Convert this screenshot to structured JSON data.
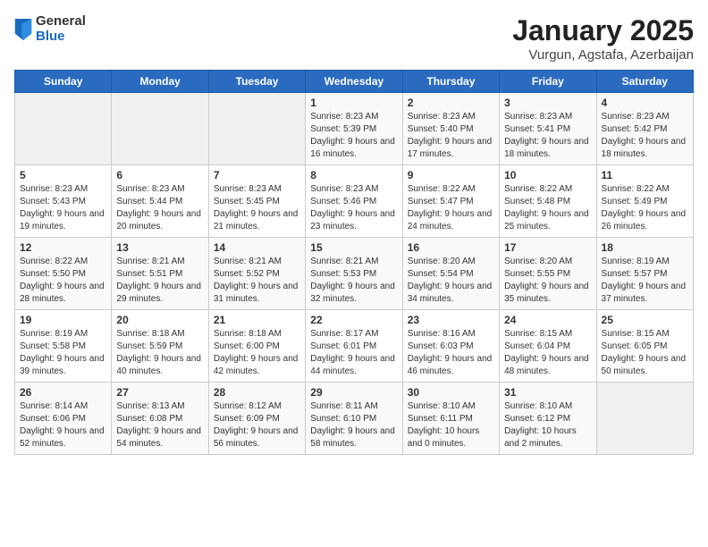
{
  "header": {
    "logo_general": "General",
    "logo_blue": "Blue",
    "title": "January 2025",
    "subtitle": "Vurgun, Agstafa, Azerbaijan"
  },
  "days_of_week": [
    "Sunday",
    "Monday",
    "Tuesday",
    "Wednesday",
    "Thursday",
    "Friday",
    "Saturday"
  ],
  "weeks": [
    [
      {
        "day": "",
        "info": ""
      },
      {
        "day": "",
        "info": ""
      },
      {
        "day": "",
        "info": ""
      },
      {
        "day": "1",
        "info": "Sunrise: 8:23 AM\nSunset: 5:39 PM\nDaylight: 9 hours and 16 minutes."
      },
      {
        "day": "2",
        "info": "Sunrise: 8:23 AM\nSunset: 5:40 PM\nDaylight: 9 hours and 17 minutes."
      },
      {
        "day": "3",
        "info": "Sunrise: 8:23 AM\nSunset: 5:41 PM\nDaylight: 9 hours and 18 minutes."
      },
      {
        "day": "4",
        "info": "Sunrise: 8:23 AM\nSunset: 5:42 PM\nDaylight: 9 hours and 18 minutes."
      }
    ],
    [
      {
        "day": "5",
        "info": "Sunrise: 8:23 AM\nSunset: 5:43 PM\nDaylight: 9 hours and 19 minutes."
      },
      {
        "day": "6",
        "info": "Sunrise: 8:23 AM\nSunset: 5:44 PM\nDaylight: 9 hours and 20 minutes."
      },
      {
        "day": "7",
        "info": "Sunrise: 8:23 AM\nSunset: 5:45 PM\nDaylight: 9 hours and 21 minutes."
      },
      {
        "day": "8",
        "info": "Sunrise: 8:23 AM\nSunset: 5:46 PM\nDaylight: 9 hours and 23 minutes."
      },
      {
        "day": "9",
        "info": "Sunrise: 8:22 AM\nSunset: 5:47 PM\nDaylight: 9 hours and 24 minutes."
      },
      {
        "day": "10",
        "info": "Sunrise: 8:22 AM\nSunset: 5:48 PM\nDaylight: 9 hours and 25 minutes."
      },
      {
        "day": "11",
        "info": "Sunrise: 8:22 AM\nSunset: 5:49 PM\nDaylight: 9 hours and 26 minutes."
      }
    ],
    [
      {
        "day": "12",
        "info": "Sunrise: 8:22 AM\nSunset: 5:50 PM\nDaylight: 9 hours and 28 minutes."
      },
      {
        "day": "13",
        "info": "Sunrise: 8:21 AM\nSunset: 5:51 PM\nDaylight: 9 hours and 29 minutes."
      },
      {
        "day": "14",
        "info": "Sunrise: 8:21 AM\nSunset: 5:52 PM\nDaylight: 9 hours and 31 minutes."
      },
      {
        "day": "15",
        "info": "Sunrise: 8:21 AM\nSunset: 5:53 PM\nDaylight: 9 hours and 32 minutes."
      },
      {
        "day": "16",
        "info": "Sunrise: 8:20 AM\nSunset: 5:54 PM\nDaylight: 9 hours and 34 minutes."
      },
      {
        "day": "17",
        "info": "Sunrise: 8:20 AM\nSunset: 5:55 PM\nDaylight: 9 hours and 35 minutes."
      },
      {
        "day": "18",
        "info": "Sunrise: 8:19 AM\nSunset: 5:57 PM\nDaylight: 9 hours and 37 minutes."
      }
    ],
    [
      {
        "day": "19",
        "info": "Sunrise: 8:19 AM\nSunset: 5:58 PM\nDaylight: 9 hours and 39 minutes."
      },
      {
        "day": "20",
        "info": "Sunrise: 8:18 AM\nSunset: 5:59 PM\nDaylight: 9 hours and 40 minutes."
      },
      {
        "day": "21",
        "info": "Sunrise: 8:18 AM\nSunset: 6:00 PM\nDaylight: 9 hours and 42 minutes."
      },
      {
        "day": "22",
        "info": "Sunrise: 8:17 AM\nSunset: 6:01 PM\nDaylight: 9 hours and 44 minutes."
      },
      {
        "day": "23",
        "info": "Sunrise: 8:16 AM\nSunset: 6:03 PM\nDaylight: 9 hours and 46 minutes."
      },
      {
        "day": "24",
        "info": "Sunrise: 8:15 AM\nSunset: 6:04 PM\nDaylight: 9 hours and 48 minutes."
      },
      {
        "day": "25",
        "info": "Sunrise: 8:15 AM\nSunset: 6:05 PM\nDaylight: 9 hours and 50 minutes."
      }
    ],
    [
      {
        "day": "26",
        "info": "Sunrise: 8:14 AM\nSunset: 6:06 PM\nDaylight: 9 hours and 52 minutes."
      },
      {
        "day": "27",
        "info": "Sunrise: 8:13 AM\nSunset: 6:08 PM\nDaylight: 9 hours and 54 minutes."
      },
      {
        "day": "28",
        "info": "Sunrise: 8:12 AM\nSunset: 6:09 PM\nDaylight: 9 hours and 56 minutes."
      },
      {
        "day": "29",
        "info": "Sunrise: 8:11 AM\nSunset: 6:10 PM\nDaylight: 9 hours and 58 minutes."
      },
      {
        "day": "30",
        "info": "Sunrise: 8:10 AM\nSunset: 6:11 PM\nDaylight: 10 hours and 0 minutes."
      },
      {
        "day": "31",
        "info": "Sunrise: 8:10 AM\nSunset: 6:12 PM\nDaylight: 10 hours and 2 minutes."
      },
      {
        "day": "",
        "info": ""
      }
    ]
  ]
}
